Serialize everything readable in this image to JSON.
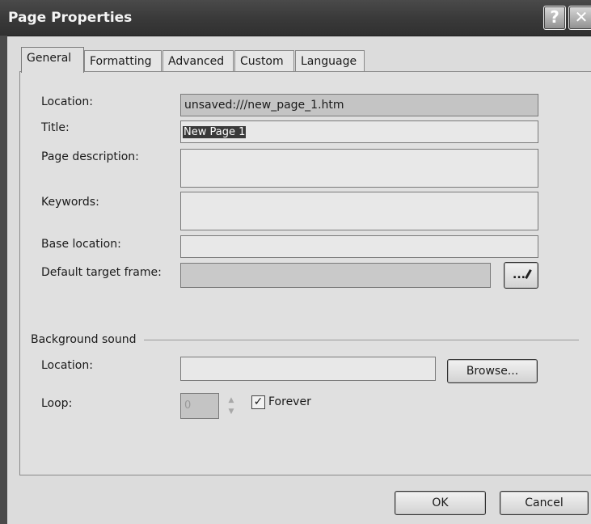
{
  "window": {
    "title": "Page Properties",
    "help_symbol": "?",
    "close_symbol": "✕"
  },
  "tabs": [
    {
      "label": "General"
    },
    {
      "label": "Formatting"
    },
    {
      "label": "Advanced"
    },
    {
      "label": "Custom"
    },
    {
      "label": "Language"
    }
  ],
  "general": {
    "location_label": "Location:",
    "location_value": "unsaved:///new_page_1.htm",
    "title_label": "Title:",
    "title_value": "New Page 1",
    "description_label": "Page description:",
    "description_value": "",
    "keywords_label": "Keywords:",
    "keywords_value": "",
    "base_location_label": "Base location:",
    "base_location_value": "",
    "target_frame_label": "Default target frame:",
    "target_frame_value": "",
    "target_frame_button": "...",
    "target_frame_button_icon": "pencil-icon"
  },
  "background_sound": {
    "group_label": "Background sound",
    "location_label": "Location:",
    "location_value": "",
    "browse_label": "Browse...",
    "loop_label": "Loop:",
    "loop_value": "0",
    "forever_label": "Forever",
    "forever_checked": true,
    "check_mark": "✓"
  },
  "footer": {
    "ok_label": "OK",
    "cancel_label": "Cancel"
  }
}
